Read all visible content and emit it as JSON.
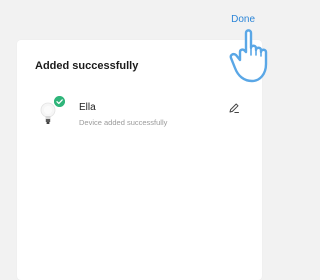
{
  "header": {
    "done_label": "Done"
  },
  "card": {
    "title": "Added successfully",
    "devices": [
      {
        "name": "Ella",
        "status": "Device added successfully",
        "icon": "bulb-icon",
        "badge_color": "#2fb57a"
      }
    ]
  },
  "colors": {
    "accent": "#2d86d8",
    "success": "#2fb57a",
    "pointer": "#5aa7e6"
  },
  "overlay": {
    "icon": "pointing-hand-icon"
  }
}
